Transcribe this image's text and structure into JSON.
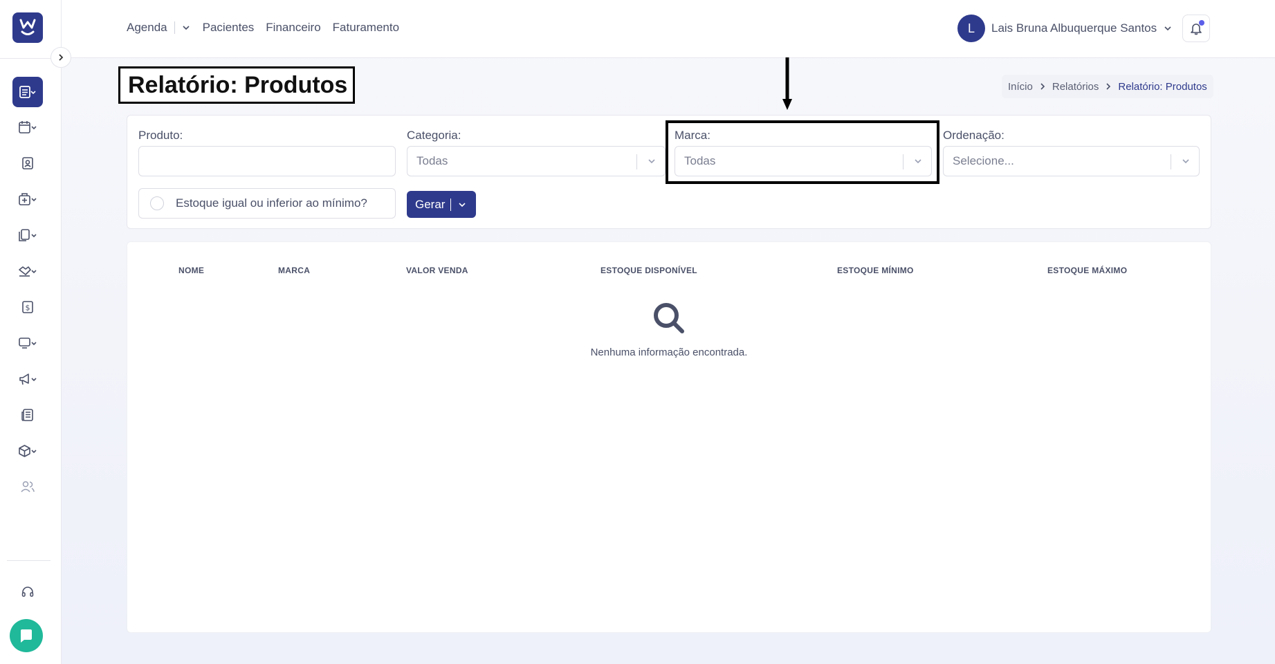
{
  "nav": {
    "agenda": "Agenda",
    "pacientes": "Pacientes",
    "financeiro": "Financeiro",
    "faturamento": "Faturamento"
  },
  "user": {
    "initial": "L",
    "name": "Lais Bruna Albuquerque Santos"
  },
  "page": {
    "title": "Relatório: Produtos"
  },
  "breadcrumb": {
    "home": "Início",
    "reports": "Relatórios",
    "current": "Relatório: Produtos"
  },
  "filters": {
    "produto_label": "Produto:",
    "produto_value": "",
    "categoria_label": "Categoria:",
    "categoria_value": "Todas",
    "marca_label": "Marca:",
    "marca_value": "Todas",
    "ordenacao_label": "Ordenação:",
    "ordenacao_value": "Selecione...",
    "estoque_checkbox": "Estoque igual ou inferior ao mínimo?",
    "gerar": "Gerar"
  },
  "table": {
    "columns": [
      "NOME",
      "MARCA",
      "VALOR VENDA",
      "ESTOQUE DISPONÍVEL",
      "ESTOQUE MÍNIMO",
      "ESTOQUE MÁXIMO"
    ],
    "empty": "Nenhuma informação encontrada."
  },
  "colors": {
    "primary": "#2e3a8c",
    "chat": "#20b99a",
    "notification": "#5b5ee8"
  }
}
